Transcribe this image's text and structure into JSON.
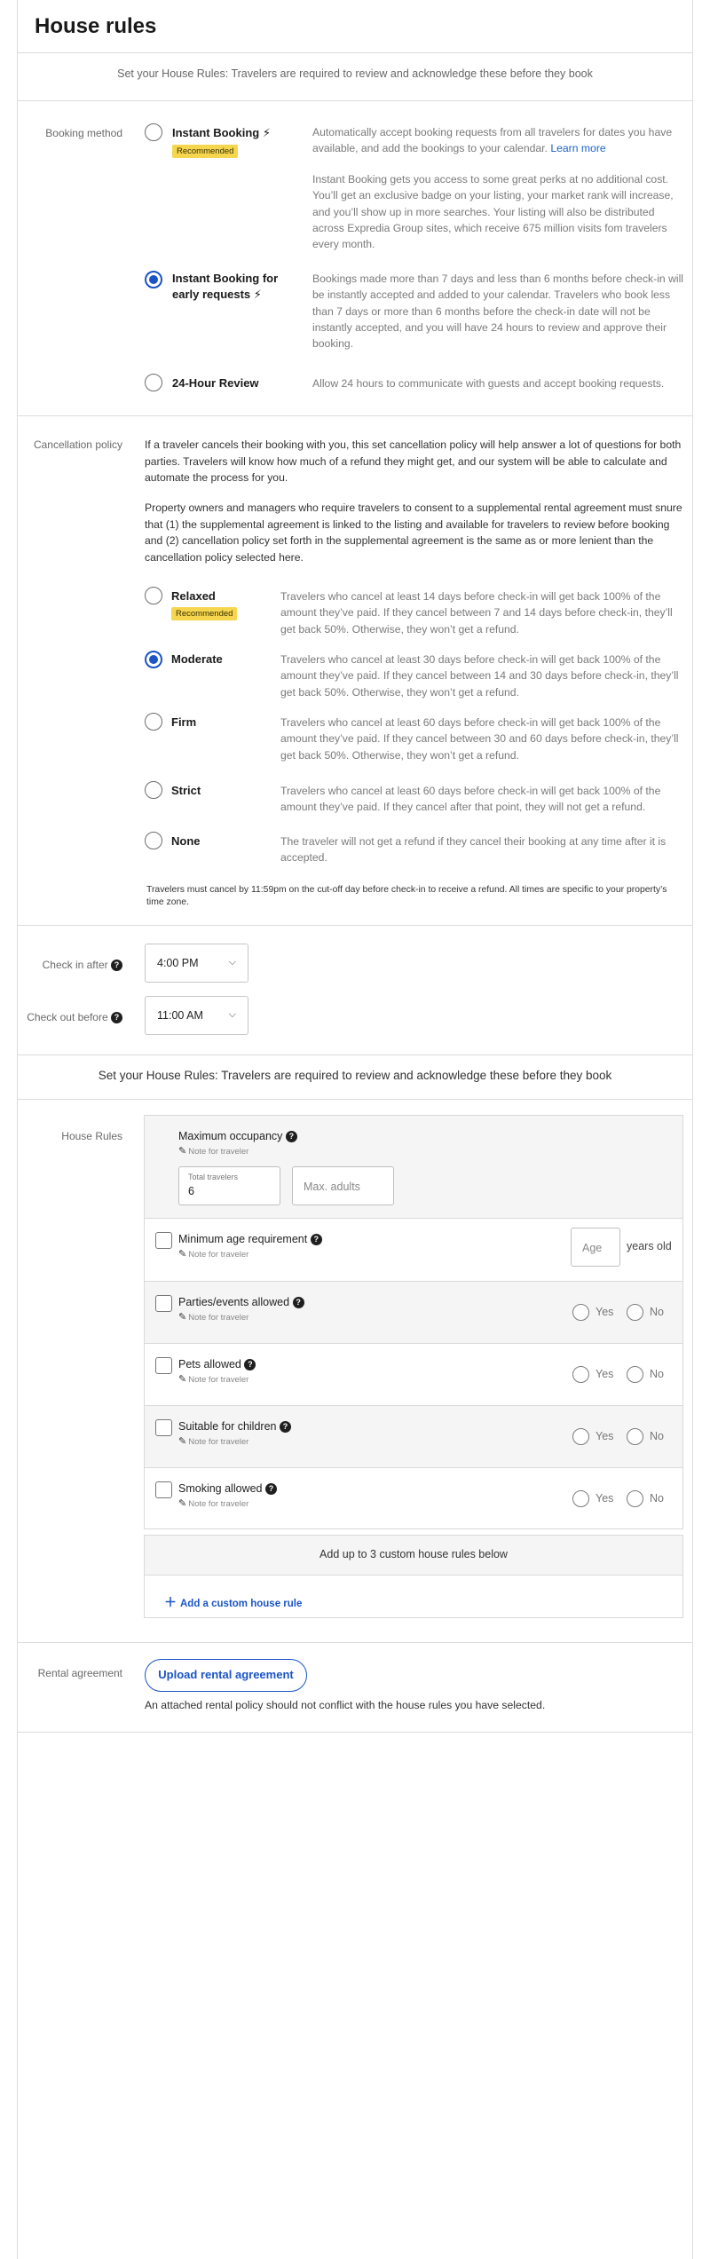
{
  "page": {
    "title": "House rules"
  },
  "intro": {
    "subhead": "Set your House Rules: Travelers are required to review and acknowledge these before they book"
  },
  "booking": {
    "label": "Booking method",
    "options": [
      {
        "title": "Instant Booking",
        "badge": "Recommended",
        "selected": false,
        "desc1_pre": "Automatically accept booking requests from all travelers for dates you have available, and add the bookings to your calendar.",
        "desc1_link": "Learn more",
        "desc2": "Instant Booking  gets you access to some great perks at no additional cost. You’ll get an exclusive badge on your listing, your market rank will increase, and you’ll show up in more searches. Your listing will also be distributed across Expredia Group sites, which receive 675 million visits fom travelers every month."
      },
      {
        "title_line1": "Instant Booking for",
        "title_line2": "early requests",
        "selected": true,
        "desc": "Bookings made more than 7 days and less than 6 months before check-in will be instantly accepted and added to your calendar. Travelers who book less than 7 days or more than 6 months before the check-in date will not be instantly accepted, and you will have 24 hours to review and approve their booking."
      },
      {
        "title": "24-Hour Review",
        "selected": false,
        "desc": "Allow 24 hours to communicate with guests and accept booking requests."
      }
    ]
  },
  "cancellation": {
    "label": "Cancellation policy",
    "para1": "If a traveler cancels their booking with you, this set cancellation policy will help answer a lot of questions for both parties. Travelers will know how much of a refund they might get, and our system will be able to calculate and automate the process for you.",
    "para2": "Property owners and managers who require travelers to consent to a supplemental rental agreement must snure that (1) the supplemental agreement is linked to the listing and available for travelers to review before booking and (2) cancellation policy set forth in the supplemental agreement is the same as or more lenient than the cancellation policy selected here.",
    "options": [
      {
        "title": "Relaxed",
        "badge": "Recommended",
        "selected": false,
        "desc": "Travelers who cancel at least 14 days before check-in will get back 100% of the amount they’ve paid. If they cancel between 7 and 14 days before check-in, they’ll get back 50%. Otherwise, they won’t get a refund."
      },
      {
        "title": "Moderate",
        "selected": true,
        "desc": "Travelers who cancel at least 30 days before check-in will get back 100% of the amount they’ve paid. If they cancel between 14 and 30 days before check-in, they’ll get back 50%. Otherwise, they won’t get a refund."
      },
      {
        "title": "Firm",
        "selected": false,
        "desc": "Travelers who cancel at least 60 days before check-in will get back 100% of the amount they’ve paid. If they cancel between 30 and 60 days before check-in, they’ll get back 50%. Otherwise, they won’t get a refund."
      },
      {
        "title": "Strict",
        "selected": false,
        "desc": "Travelers who cancel at least 60 days before check-in will get back 100% of the amount they’ve paid. If they cancel after that point, they will not get a refund."
      },
      {
        "title": "None",
        "selected": false,
        "desc": "The traveler will not get a refund if they cancel their booking at any time after it is accepted."
      }
    ],
    "footnote": "Travelers must cancel by 11:59pm on the cut-off day before check-in to receive a refund. All times are specific to your property’s time zone."
  },
  "checkin": {
    "label": "Check in after",
    "value": "4:00 PM"
  },
  "checkout": {
    "label": "Check out before",
    "value": "11:00 AM"
  },
  "house_rules_intro": "Set your House Rules: Travelers are required to review and acknowledge these before they book",
  "house_rules": {
    "label": "House Rules",
    "note": "Note for traveler",
    "max_occupancy": {
      "title": "Maximum occupancy",
      "total_label": "Total travelers",
      "total_value": "6",
      "adults_placeholder": "Max. adults"
    },
    "min_age": {
      "title": "Minimum age requirement",
      "age_placeholder": "Age",
      "suffix": "years old"
    },
    "yes": "Yes",
    "no": "No",
    "rules": [
      "Parties/events allowed",
      "Pets allowed",
      "Suitable for children",
      "Smoking allowed"
    ],
    "custom_header": "Add up to 3 custom house rules below",
    "add_custom": "Add a custom house rule"
  },
  "rental": {
    "label": "Rental agreement",
    "button": "Upload rental agreement",
    "note": "An attached rental policy should not conflict with the house rules you have selected."
  }
}
